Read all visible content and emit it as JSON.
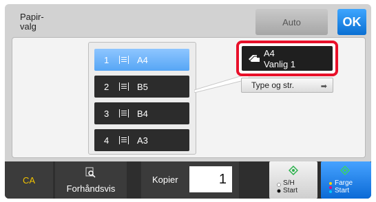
{
  "header": {
    "title": "Papir-\nvalg",
    "auto_label": "Auto",
    "ok_label": "OK"
  },
  "trays": [
    {
      "num": "1",
      "size": "A4",
      "selected": true
    },
    {
      "num": "2",
      "size": "B5",
      "selected": false
    },
    {
      "num": "3",
      "size": "B4",
      "selected": false
    },
    {
      "num": "4",
      "size": "A3",
      "selected": false
    }
  ],
  "selected_paper": {
    "text": "A4\nVanlig 1",
    "icon": "paper-tray-icon"
  },
  "type_button": {
    "label": "Type og str.",
    "icon": "arrow-right-icon"
  },
  "bottom_bar": {
    "ca_label": "CA",
    "preview_label": "Forhåndsvis",
    "preview_icon": "magnifier-icon",
    "copies_label": "Kopier",
    "copies_value": "1",
    "bw_start_label": "S/H\nStart",
    "color_start_label": "Farge\nStart",
    "start_icon": "diamond-start-icon"
  },
  "colors": {
    "highlight_red": "#e8102a",
    "accent_blue": "#0a6fd2",
    "ca_yellow": "#f2c300"
  }
}
